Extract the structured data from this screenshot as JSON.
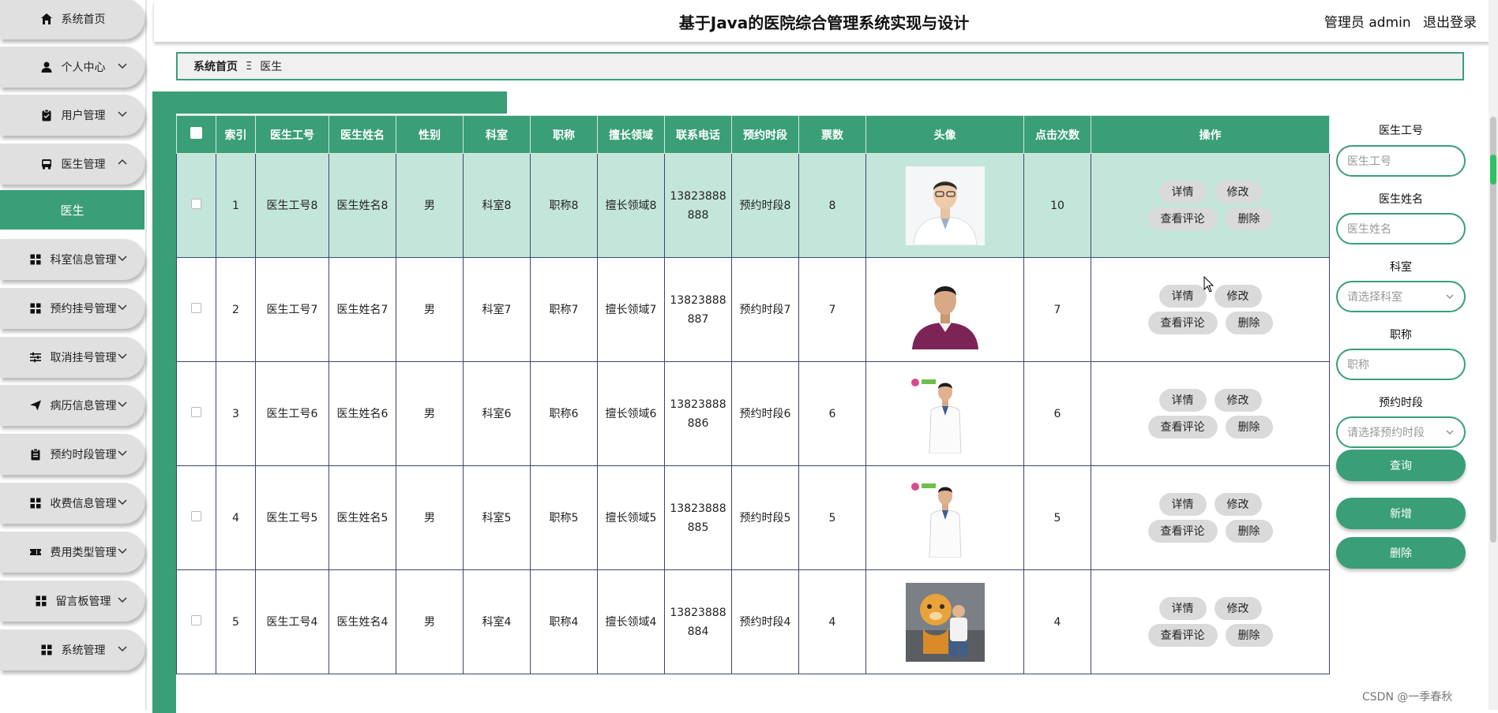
{
  "app": {
    "title": "基于Java的医院综合管理系统实现与设计",
    "user_label": "管理员 admin",
    "logout_label": "退出登录"
  },
  "breadcrumb": {
    "home": "系统首页",
    "separator": "Ξ",
    "current": "医生"
  },
  "sidebar": {
    "items": [
      {
        "label": "系统首页",
        "icon": "home-icon"
      },
      {
        "label": "个人中心",
        "icon": "user-icon"
      },
      {
        "label": "用户管理",
        "icon": "clipboard-icon"
      },
      {
        "label": "医生管理",
        "icon": "bus-icon"
      },
      {
        "label": "科室信息管理",
        "icon": "grid-icon"
      },
      {
        "label": "预约挂号管理",
        "icon": "grid-icon"
      },
      {
        "label": "取消挂号管理",
        "icon": "sliders-icon"
      },
      {
        "label": "病历信息管理",
        "icon": "send-icon"
      },
      {
        "label": "预约时段管理",
        "icon": "clipboard-icon"
      },
      {
        "label": "收费信息管理",
        "icon": "grid-icon"
      },
      {
        "label": "费用类型管理",
        "icon": "ticket-icon"
      },
      {
        "label": "留言板管理",
        "icon": "grid-icon"
      },
      {
        "label": "系统管理",
        "icon": "grid-icon"
      }
    ],
    "submenu_active": "医生"
  },
  "table": {
    "headers": [
      "",
      "索引",
      "医生工号",
      "医生姓名",
      "性别",
      "科室",
      "职称",
      "擅长领域",
      "联系电话",
      "预约时段",
      "票数",
      "头像",
      "点击次数",
      "操作"
    ],
    "rows": [
      {
        "index": "1",
        "doctor_id": "医生工号8",
        "doctor_name": "医生姓名8",
        "gender": "男",
        "department": "科室8",
        "title": "职称8",
        "specialty": "擅长领域8",
        "phone": "13823888888",
        "time_slot": "预约时段8",
        "votes": "8",
        "clicks": "10",
        "highlighted": true
      },
      {
        "index": "2",
        "doctor_id": "医生工号7",
        "doctor_name": "医生姓名7",
        "gender": "男",
        "department": "科室7",
        "title": "职称7",
        "specialty": "擅长领域7",
        "phone": "13823888887",
        "time_slot": "预约时段7",
        "votes": "7",
        "clicks": "7",
        "highlighted": false
      },
      {
        "index": "3",
        "doctor_id": "医生工号6",
        "doctor_name": "医生姓名6",
        "gender": "男",
        "department": "科室6",
        "title": "职称6",
        "specialty": "擅长领域6",
        "phone": "13823888886",
        "time_slot": "预约时段6",
        "votes": "6",
        "clicks": "6",
        "highlighted": false
      },
      {
        "index": "4",
        "doctor_id": "医生工号5",
        "doctor_name": "医生姓名5",
        "gender": "男",
        "department": "科室5",
        "title": "职称5",
        "specialty": "擅长领域5",
        "phone": "13823888885",
        "time_slot": "预约时段5",
        "votes": "5",
        "clicks": "5",
        "highlighted": false
      },
      {
        "index": "5",
        "doctor_id": "医生工号4",
        "doctor_name": "医生姓名4",
        "gender": "男",
        "department": "科室4",
        "title": "职称4",
        "specialty": "擅长领域4",
        "phone": "13823888884",
        "time_slot": "预约时段4",
        "votes": "4",
        "clicks": "4",
        "highlighted": false
      }
    ],
    "actions": {
      "detail": "详情",
      "edit": "修改",
      "comments": "查看评论",
      "delete": "删除"
    }
  },
  "search": {
    "id_label": "医生工号",
    "id_placeholder": "医生工号",
    "name_label": "医生姓名",
    "name_placeholder": "医生姓名",
    "dept_label": "科室",
    "dept_placeholder": "请选择科室",
    "title_label": "职称",
    "title_placeholder": "职称",
    "slot_label": "预约时段",
    "slot_placeholder": "请选择预约时段",
    "query_button": "查询",
    "add_button": "新增",
    "delete_button": "删除"
  },
  "watermark": "CSDN @一季春秋",
  "colors": {
    "accent": "#3a9e77",
    "row_highlight": "#c4e6da",
    "menu_bg": "#e0e0e0",
    "pill_bg": "#dadada"
  }
}
